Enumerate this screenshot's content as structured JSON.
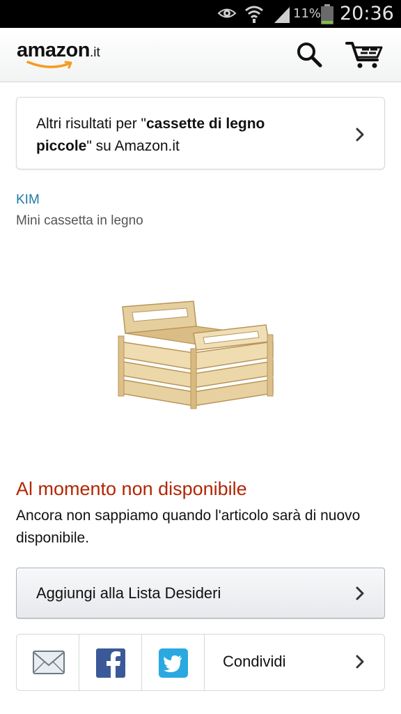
{
  "status_bar": {
    "battery_percent": "11%",
    "time": "20:36",
    "icons": [
      "eye-icon",
      "wifi-icon",
      "signal-icon",
      "battery-icon"
    ]
  },
  "header": {
    "logo_word": "amazon",
    "logo_tld": ".it",
    "icons": [
      "search-icon",
      "cart-icon"
    ]
  },
  "more_results": {
    "prefix": "Altri risultati per \"",
    "query_part1": "cassette di legno",
    "query_part2": "piccole",
    "suffix": "\" su Amazon.it"
  },
  "product": {
    "brand": "KIM",
    "title": "Mini cassetta in legno",
    "image": "wooden-crate-image"
  },
  "availability": {
    "status": "Al momento non disponibile",
    "note": "Ancora non sappiamo quando l'articolo sarà di nuovo disponibile."
  },
  "wishlist": {
    "label": "Aggiungi alla Lista Desideri"
  },
  "share": {
    "label": "Condividi",
    "icons": [
      "email-icon",
      "facebook-icon",
      "twitter-icon"
    ]
  },
  "colors": {
    "brand_link": "#1f7aa6",
    "unavailable": "#b12704",
    "logo_smile": "#f79a1e"
  }
}
